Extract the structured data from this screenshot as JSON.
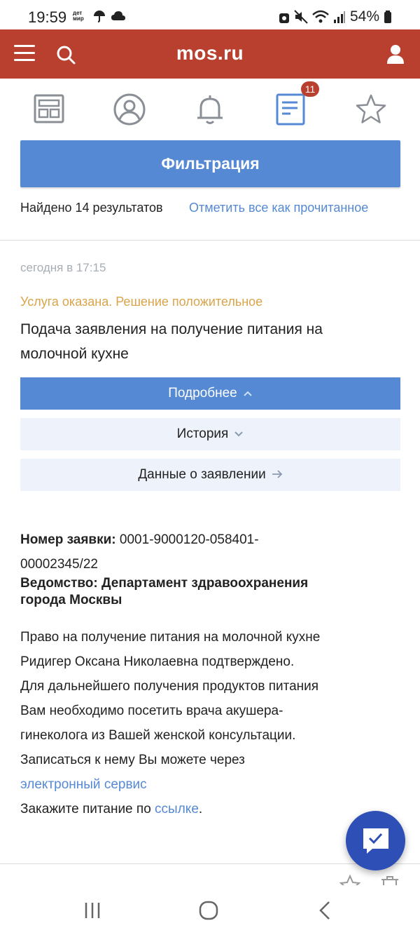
{
  "status_bar": {
    "time": "19:59",
    "small_label": "дет мир",
    "battery": "54%"
  },
  "header": {
    "logo": "mos.ru",
    "accent_color": "#b9402e"
  },
  "tabs": {
    "items": [
      {
        "icon": "dashboard-icon"
      },
      {
        "icon": "profile-icon"
      },
      {
        "icon": "bell-icon"
      },
      {
        "icon": "document-list-icon",
        "active": true
      },
      {
        "icon": "star-icon"
      }
    ],
    "badge": "11"
  },
  "filter": {
    "button_label": "Фильтрация"
  },
  "results": {
    "found": "Найдено 14 результатов",
    "mark_all_read": "Отметить все как прочитанное"
  },
  "notification": {
    "date": "сегодня в 17:15",
    "status": "Услуга оказана. Решение положительное",
    "title": "Подача заявления на получение питания на молочной кухне",
    "more_label": "Подробнее",
    "history_label": "История",
    "data_label": "Данные о заявлении",
    "app_number_label": "Номер заявки:",
    "app_number_value": "0001-9000120-058401-00002345/22",
    "dept_label": "Ведомство:",
    "dept_value": "Департамент здравоохранения города Москвы",
    "text_1": "Право на получение питания на молочной кухне Ридигер Оксана Николаевна подтверждено.",
    "text_2": "Для дальнейшего получения продуктов питания Вам необходимо посетить врача акушера-гинеколога из Вашей женской консультации. Записаться к нему Вы можете через",
    "link_1": "электронный сервис",
    "text_3": "Закажите питание по",
    "link_2": "ссылке",
    "text_4": "."
  },
  "colors": {
    "primary": "#5589d4",
    "status_positive": "#d9a44a",
    "fab": "#2e4fb6"
  }
}
